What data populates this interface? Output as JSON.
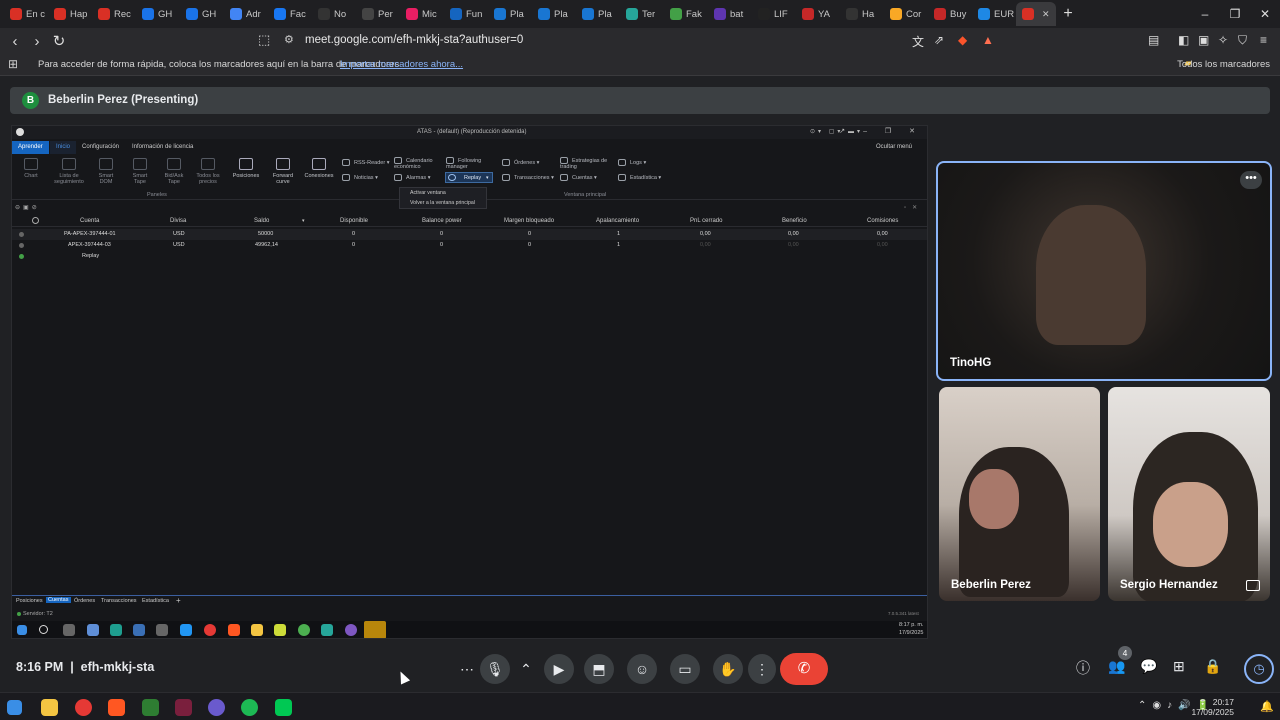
{
  "browser": {
    "tabs": [
      "En c",
      "Hap",
      "Rec",
      "GH",
      "GH",
      "Adr",
      "Fac",
      "No",
      "Per",
      "Mic",
      "Fun",
      "Pla",
      "Pla",
      "Pla",
      "Ter",
      "Fak",
      "bat",
      "LIF",
      "YA",
      "Ha",
      "Cor",
      "Buy",
      "EUR",
      ""
    ],
    "tab_colors": [
      "#d93025",
      "#d93025",
      "#d93025",
      "#1a73e8",
      "#1a73e8",
      "#4285f4",
      "#1877f2",
      "#333333",
      "#444444",
      "#e91e63",
      "#1565c0",
      "#1976d2",
      "#1976d2",
      "#1976d2",
      "#26a69a",
      "#43a047",
      "#5e35b1",
      "#222222",
      "#c62828",
      "#333333",
      "#f9a825",
      "#c62828",
      "#1e88e5",
      "#d93025"
    ],
    "url": "meet.google.com/efh-mkkj-sta?authuser=0",
    "bookmarks_message": "Para acceder de forma rápida, coloca los marcadores aquí en la barra de marcadores",
    "bookmarks_import": "Importar marcadores ahora...",
    "bookmarks_all": "Todos los marcadores",
    "window_controls": [
      "–",
      "❐",
      "✕"
    ]
  },
  "presenter": {
    "avatar_letter": "B",
    "label": "Beberlin Perez (Presenting)"
  },
  "shared_app": {
    "title": "ATAS - (default) (Reproducción detenida)",
    "menu_tabs": [
      "Aprender",
      "Inicio",
      "Configuración",
      "Información de licencia"
    ],
    "ocultar": "Ocultar menú",
    "ribbon_left": [
      {
        "label": "Chart"
      },
      {
        "label": "Lista de seguimiento"
      },
      {
        "label": "Smart DOM"
      },
      {
        "label": "Smart Tape"
      },
      {
        "label": "Bid/Ask Tape"
      },
      {
        "label": "Todos los precios"
      },
      {
        "label": "Posiciones"
      },
      {
        "label": "Forward curve"
      },
      {
        "label": "Conexiones"
      }
    ],
    "ribbon_groups": {
      "paneles": "Paneles",
      "ventana": "Ventana principal"
    },
    "ribbon_right": [
      "RSS-Reader",
      "Calendario económico",
      "Following manager",
      "Órdenes",
      "Estrategias de trading",
      "Logs",
      "Noticias",
      "Alarmas",
      "Replay",
      "Transacciones",
      "Cuentas",
      "Estadística"
    ],
    "dropdown": [
      "Activar ventana",
      "Volver a la ventana principal"
    ],
    "columns": [
      "Cuenta",
      "Divisa",
      "Saldo",
      "Disponible",
      "Balance power",
      "Margen bloqueado",
      "Apalancamiento",
      "PnL cerrado",
      "Beneficio",
      "Comisiones"
    ],
    "rows": [
      [
        "PA-APEX-397444-01",
        "USD",
        "50000",
        "0",
        "0",
        "0",
        "1",
        "0,00",
        "0,00",
        "0,00"
      ],
      [
        "APEX-397444-03",
        "USD",
        "49962,14",
        "0",
        "0",
        "0",
        "1",
        "0,00",
        "0,00",
        "0,00"
      ],
      [
        "Replay",
        "",
        "",
        "",
        "",
        "",
        "",
        "",
        "",
        ""
      ]
    ],
    "bottom_tabs": [
      "Posiciones",
      "Cuentas",
      "Órdenes",
      "Transacciones",
      "Estadística"
    ],
    "status": "Servidor: T2",
    "version": "7.0.5.341 latest",
    "inner_clock": "8:17 p. m.",
    "inner_date": "17/9/2025"
  },
  "participants": [
    {
      "name": "TinoHG"
    },
    {
      "name": "Beberlin Perez"
    },
    {
      "name": "Sergio Hernandez"
    }
  ],
  "meet": {
    "time": "8:16 PM",
    "separator": "|",
    "code": "efh-mkkj-sta",
    "people_count": "4"
  },
  "taskbar": {
    "time": "20:17",
    "date": "17/09/2025"
  }
}
